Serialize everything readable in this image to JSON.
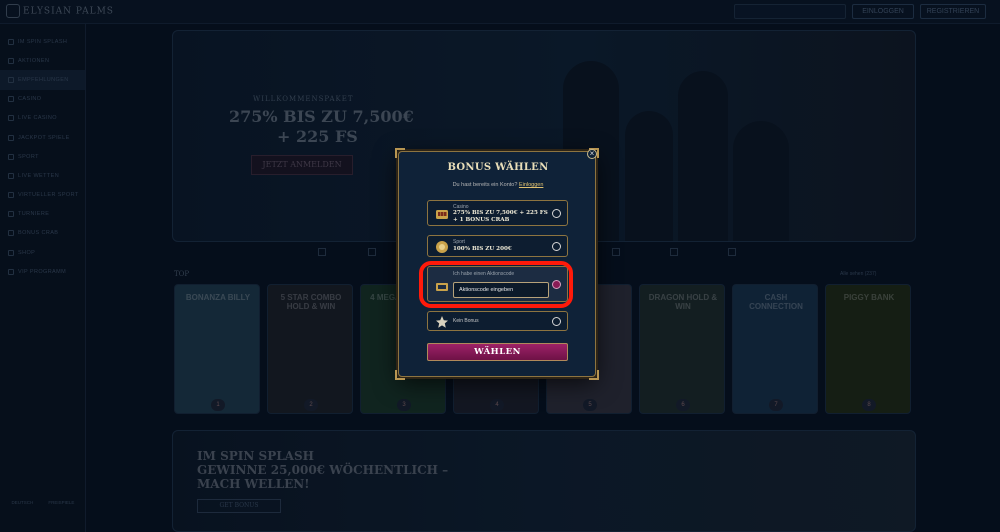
{
  "header": {
    "logo": "ELYSIAN PALMS",
    "login_label": "EINLOGGEN",
    "register_label": "REGISTRIEREN"
  },
  "sidebar": {
    "items": [
      {
        "label": "IM SPIN SPLASH"
      },
      {
        "label": "AKTIONEN"
      },
      {
        "label": "EMPFEHLUNGEN"
      },
      {
        "label": "CASINO"
      },
      {
        "label": "LIVE CASINO"
      },
      {
        "label": "JACKPOT SPIELE"
      },
      {
        "label": "SPORT"
      },
      {
        "label": "LIVE WETTEN"
      },
      {
        "label": "VIRTUELLER SPORT"
      },
      {
        "label": "TURNIERE"
      },
      {
        "label": "BONUS CRAB"
      },
      {
        "label": "SHOP"
      },
      {
        "label": "VIP PROGRAMM"
      }
    ],
    "footer": [
      "DEUTSCH",
      "FREISPIELE"
    ]
  },
  "hero": {
    "pre": "WILLKOMMENSPAKET",
    "line1": "275% BIS ZU 7,500€",
    "line2": "+ 225 FS",
    "cta": "JETZT ANMELDEN"
  },
  "top": {
    "label": "TOP",
    "all": "Alle sehen (237)",
    "games": [
      {
        "title": "BONANZA BILLY",
        "rank": "1",
        "color": "#1e3a4a"
      },
      {
        "title": "5 STAR COMBO HOLD & WIN",
        "rank": "2",
        "color": "#1b1f26"
      },
      {
        "title": "4 MEGA HOTFIRE",
        "rank": "3",
        "color": "#173326"
      },
      {
        "title": "",
        "rank": "4",
        "color": "#1d1f2a"
      },
      {
        "title": "",
        "rank": "5",
        "color": "#2f2f3a"
      },
      {
        "title": "DRAGON HOLD & WIN",
        "rank": "6",
        "color": "#1c2a28"
      },
      {
        "title": "CASH CONNECTION",
        "rank": "7",
        "color": "#163048"
      },
      {
        "title": "PIGGY BANK",
        "rank": "8",
        "color": "#1f2a14"
      }
    ]
  },
  "promo": {
    "line1": "IM SPIN SPLASH",
    "line2": "GEWINNE 25,000€ WÖCHENTLICH –",
    "line3": "MACH WELLEN!",
    "cta": "GET BONUS"
  },
  "modal": {
    "title": "BONUS WÄHLEN",
    "subtitle": "Du hast bereits ein Konto?",
    "login_link": "Einloggen",
    "options": {
      "casino": {
        "category": "Casino",
        "line1": "275% BIS ZU 7,500€ + 225 FS",
        "line2": "+ 1 BONUS CRAB"
      },
      "sport": {
        "category": "Sport",
        "line1": "100% BIS ZU 200€"
      },
      "code": {
        "category": "Ich habe einen Aktionscode",
        "placeholder": "Aktionscode eingeben"
      },
      "none": {
        "category": "Kein Bonus"
      }
    },
    "submit_label": "WÄHLEN",
    "highlight_color": "#ff1a0a",
    "accent_color": "#9d2267"
  }
}
